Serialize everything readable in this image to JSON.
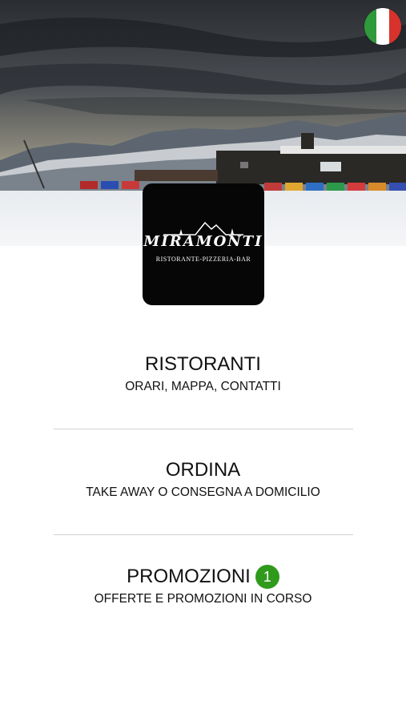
{
  "language_flag": {
    "icon": "italian-flag-icon",
    "colors": [
      "#2f9a3a",
      "#ffffff",
      "#d7322c"
    ]
  },
  "logo": {
    "name": "MIRAMONTI",
    "tagline": "RISTORANTE-PIZZERIA-BAR"
  },
  "menu": [
    {
      "title": "RISTORANTI",
      "subtitle": "ORARI, MAPPA, CONTATTI"
    },
    {
      "title": "ORDINA",
      "subtitle": "TAKE AWAY O CONSEGNA A DOMICILIO"
    },
    {
      "title": "PROMOZIONI",
      "subtitle": "OFFERTE E PROMOZIONI IN CORSO",
      "badge": "1"
    }
  ],
  "colors": {
    "badge": "#2f9a1b",
    "divider": "#d3d3d3"
  }
}
